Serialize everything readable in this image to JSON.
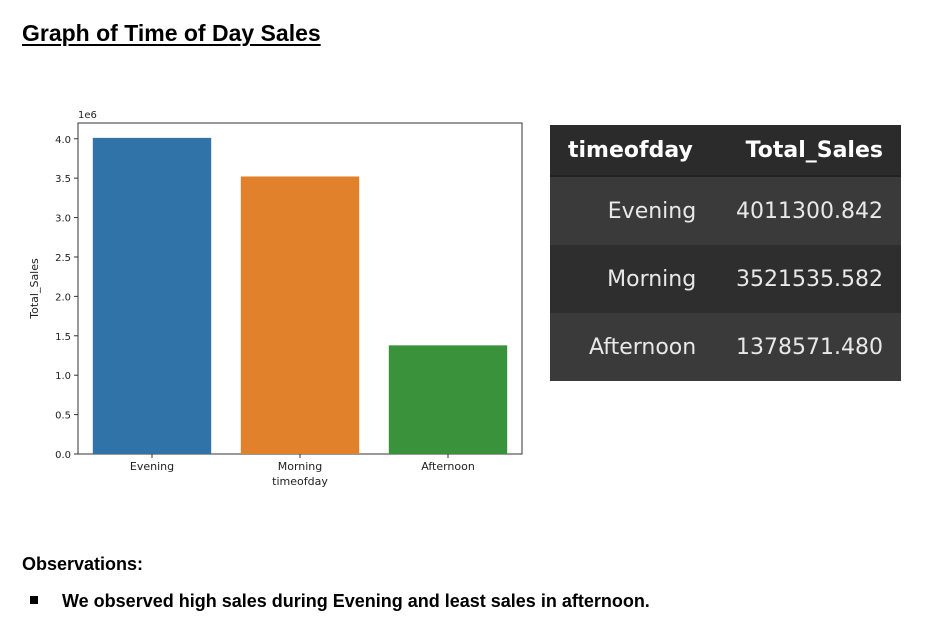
{
  "document": {
    "title": "Graph of Time of Day Sales",
    "observations_heading": "Observations:",
    "observations": [
      "We observed high sales during Evening and least sales in afternoon."
    ]
  },
  "table": {
    "columns": [
      "timeofday",
      "Total_Sales"
    ],
    "rows": [
      [
        "Evening",
        "4011300.842"
      ],
      [
        "Morning",
        "3521535.582"
      ],
      [
        "Afternoon",
        "1378571.480"
      ]
    ]
  },
  "chart_data": {
    "type": "bar",
    "categories": [
      "Evening",
      "Morning",
      "Afternoon"
    ],
    "values": [
      4011300.842,
      3521535.582,
      1378571.48
    ],
    "colors": [
      "#2f73a8",
      "#e1812c",
      "#3a923a"
    ],
    "title": "",
    "xlabel": "timeofday",
    "ylabel": "Total_Sales",
    "scale_label": "1e6",
    "ylim": [
      0,
      4200000
    ],
    "yticks": [
      0,
      500000,
      1000000,
      1500000,
      2000000,
      2500000,
      3000000,
      3500000,
      4000000
    ],
    "ytick_labels": [
      "0.0",
      "0.5",
      "1.0",
      "1.5",
      "2.0",
      "2.5",
      "3.0",
      "3.5",
      "4.0"
    ],
    "grid": false,
    "legend": "none"
  }
}
